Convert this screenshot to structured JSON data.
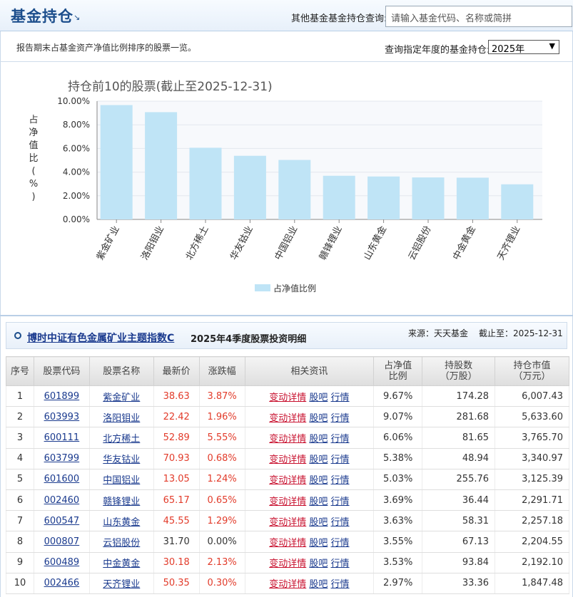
{
  "header": {
    "title": "基金持仓",
    "query_label": "其他基金基金持仓查询:",
    "search_placeholder": "请输入基金代码、名称或简拼"
  },
  "subheader": {
    "description": "报告期末占基金资产净值比例排序的股票一览。",
    "year_query_label": "查询指定年度的基金持仓:",
    "year_selected": "2025年"
  },
  "chart_data": {
    "type": "bar",
    "title": "持仓前10的股票(截止至2025-12-31)",
    "ylabel": "占净值比(%)",
    "xlabel": "",
    "categories": [
      "紫金矿业",
      "洛阳钼业",
      "北方稀土",
      "华友钴业",
      "中国铝业",
      "赣锋锂业",
      "山东黄金",
      "云铝股份",
      "中金黄金",
      "天齐锂业"
    ],
    "series": [
      {
        "name": "占净值比例",
        "values": [
          9.67,
          9.07,
          6.06,
          5.38,
          5.03,
          3.69,
          3.63,
          3.55,
          3.53,
          2.97
        ]
      }
    ],
    "ylim": [
      0,
      10
    ],
    "yticks": [
      "0.00%",
      "2.00%",
      "4.00%",
      "6.00%",
      "8.00%",
      "10.00%"
    ],
    "ytick_values": [
      0,
      2,
      4,
      6,
      8,
      10
    ],
    "grid": true,
    "legend": "bottom-center",
    "bar_color": "#bfe4f6"
  },
  "section": {
    "fund_name": "博时中证有色金属矿业主题指数C",
    "subtitle": "2025年4季度股票投资明细",
    "source": "来源：天天基金",
    "as_of": "截止至：2025-12-31"
  },
  "table": {
    "headers": {
      "seq": "序号",
      "code": "股票代码",
      "name": "股票名称",
      "price": "最新价",
      "change": "涨跌幅",
      "links": "相关资讯",
      "ratio_1": "占净值",
      "ratio_2": "比例",
      "shares_1": "持股数",
      "shares_2": "（万股）",
      "value_1": "持仓市值",
      "value_2": "（万元）"
    },
    "link_labels": {
      "detail": "变动详情",
      "bar": "股吧",
      "quote": "行情"
    },
    "rows": [
      {
        "seq": "1",
        "code": "601899",
        "name": "紫金矿业",
        "price": "38.63",
        "change": "3.87%",
        "ratio": "9.67%",
        "shares": "174.28",
        "value": "6,007.43"
      },
      {
        "seq": "2",
        "code": "603993",
        "name": "洛阳钼业",
        "price": "22.42",
        "change": "1.96%",
        "ratio": "9.07%",
        "shares": "281.68",
        "value": "5,633.60"
      },
      {
        "seq": "3",
        "code": "600111",
        "name": "北方稀土",
        "price": "52.89",
        "change": "5.55%",
        "ratio": "6.06%",
        "shares": "81.65",
        "value": "3,765.70"
      },
      {
        "seq": "4",
        "code": "603799",
        "name": "华友钴业",
        "price": "70.93",
        "change": "0.68%",
        "ratio": "5.38%",
        "shares": "48.94",
        "value": "3,340.97"
      },
      {
        "seq": "5",
        "code": "601600",
        "name": "中国铝业",
        "price": "13.05",
        "change": "1.24%",
        "ratio": "5.03%",
        "shares": "255.76",
        "value": "3,125.39"
      },
      {
        "seq": "6",
        "code": "002460",
        "name": "赣锋锂业",
        "price": "65.17",
        "change": "0.65%",
        "ratio": "3.69%",
        "shares": "36.44",
        "value": "2,291.71"
      },
      {
        "seq": "7",
        "code": "600547",
        "name": "山东黄金",
        "price": "45.55",
        "change": "1.29%",
        "ratio": "3.63%",
        "shares": "58.31",
        "value": "2,257.18"
      },
      {
        "seq": "8",
        "code": "000807",
        "name": "云铝股份",
        "price": "31.70",
        "change": "0.00%",
        "ratio": "3.55%",
        "shares": "67.13",
        "value": "2,204.55"
      },
      {
        "seq": "9",
        "code": "600489",
        "name": "中金黄金",
        "price": "30.18",
        "change": "2.13%",
        "ratio": "3.53%",
        "shares": "93.84",
        "value": "2,192.10"
      },
      {
        "seq": "10",
        "code": "002466",
        "name": "天齐锂业",
        "price": "50.35",
        "change": "0.30%",
        "ratio": "2.97%",
        "shares": "33.36",
        "value": "1,847.48"
      }
    ]
  }
}
